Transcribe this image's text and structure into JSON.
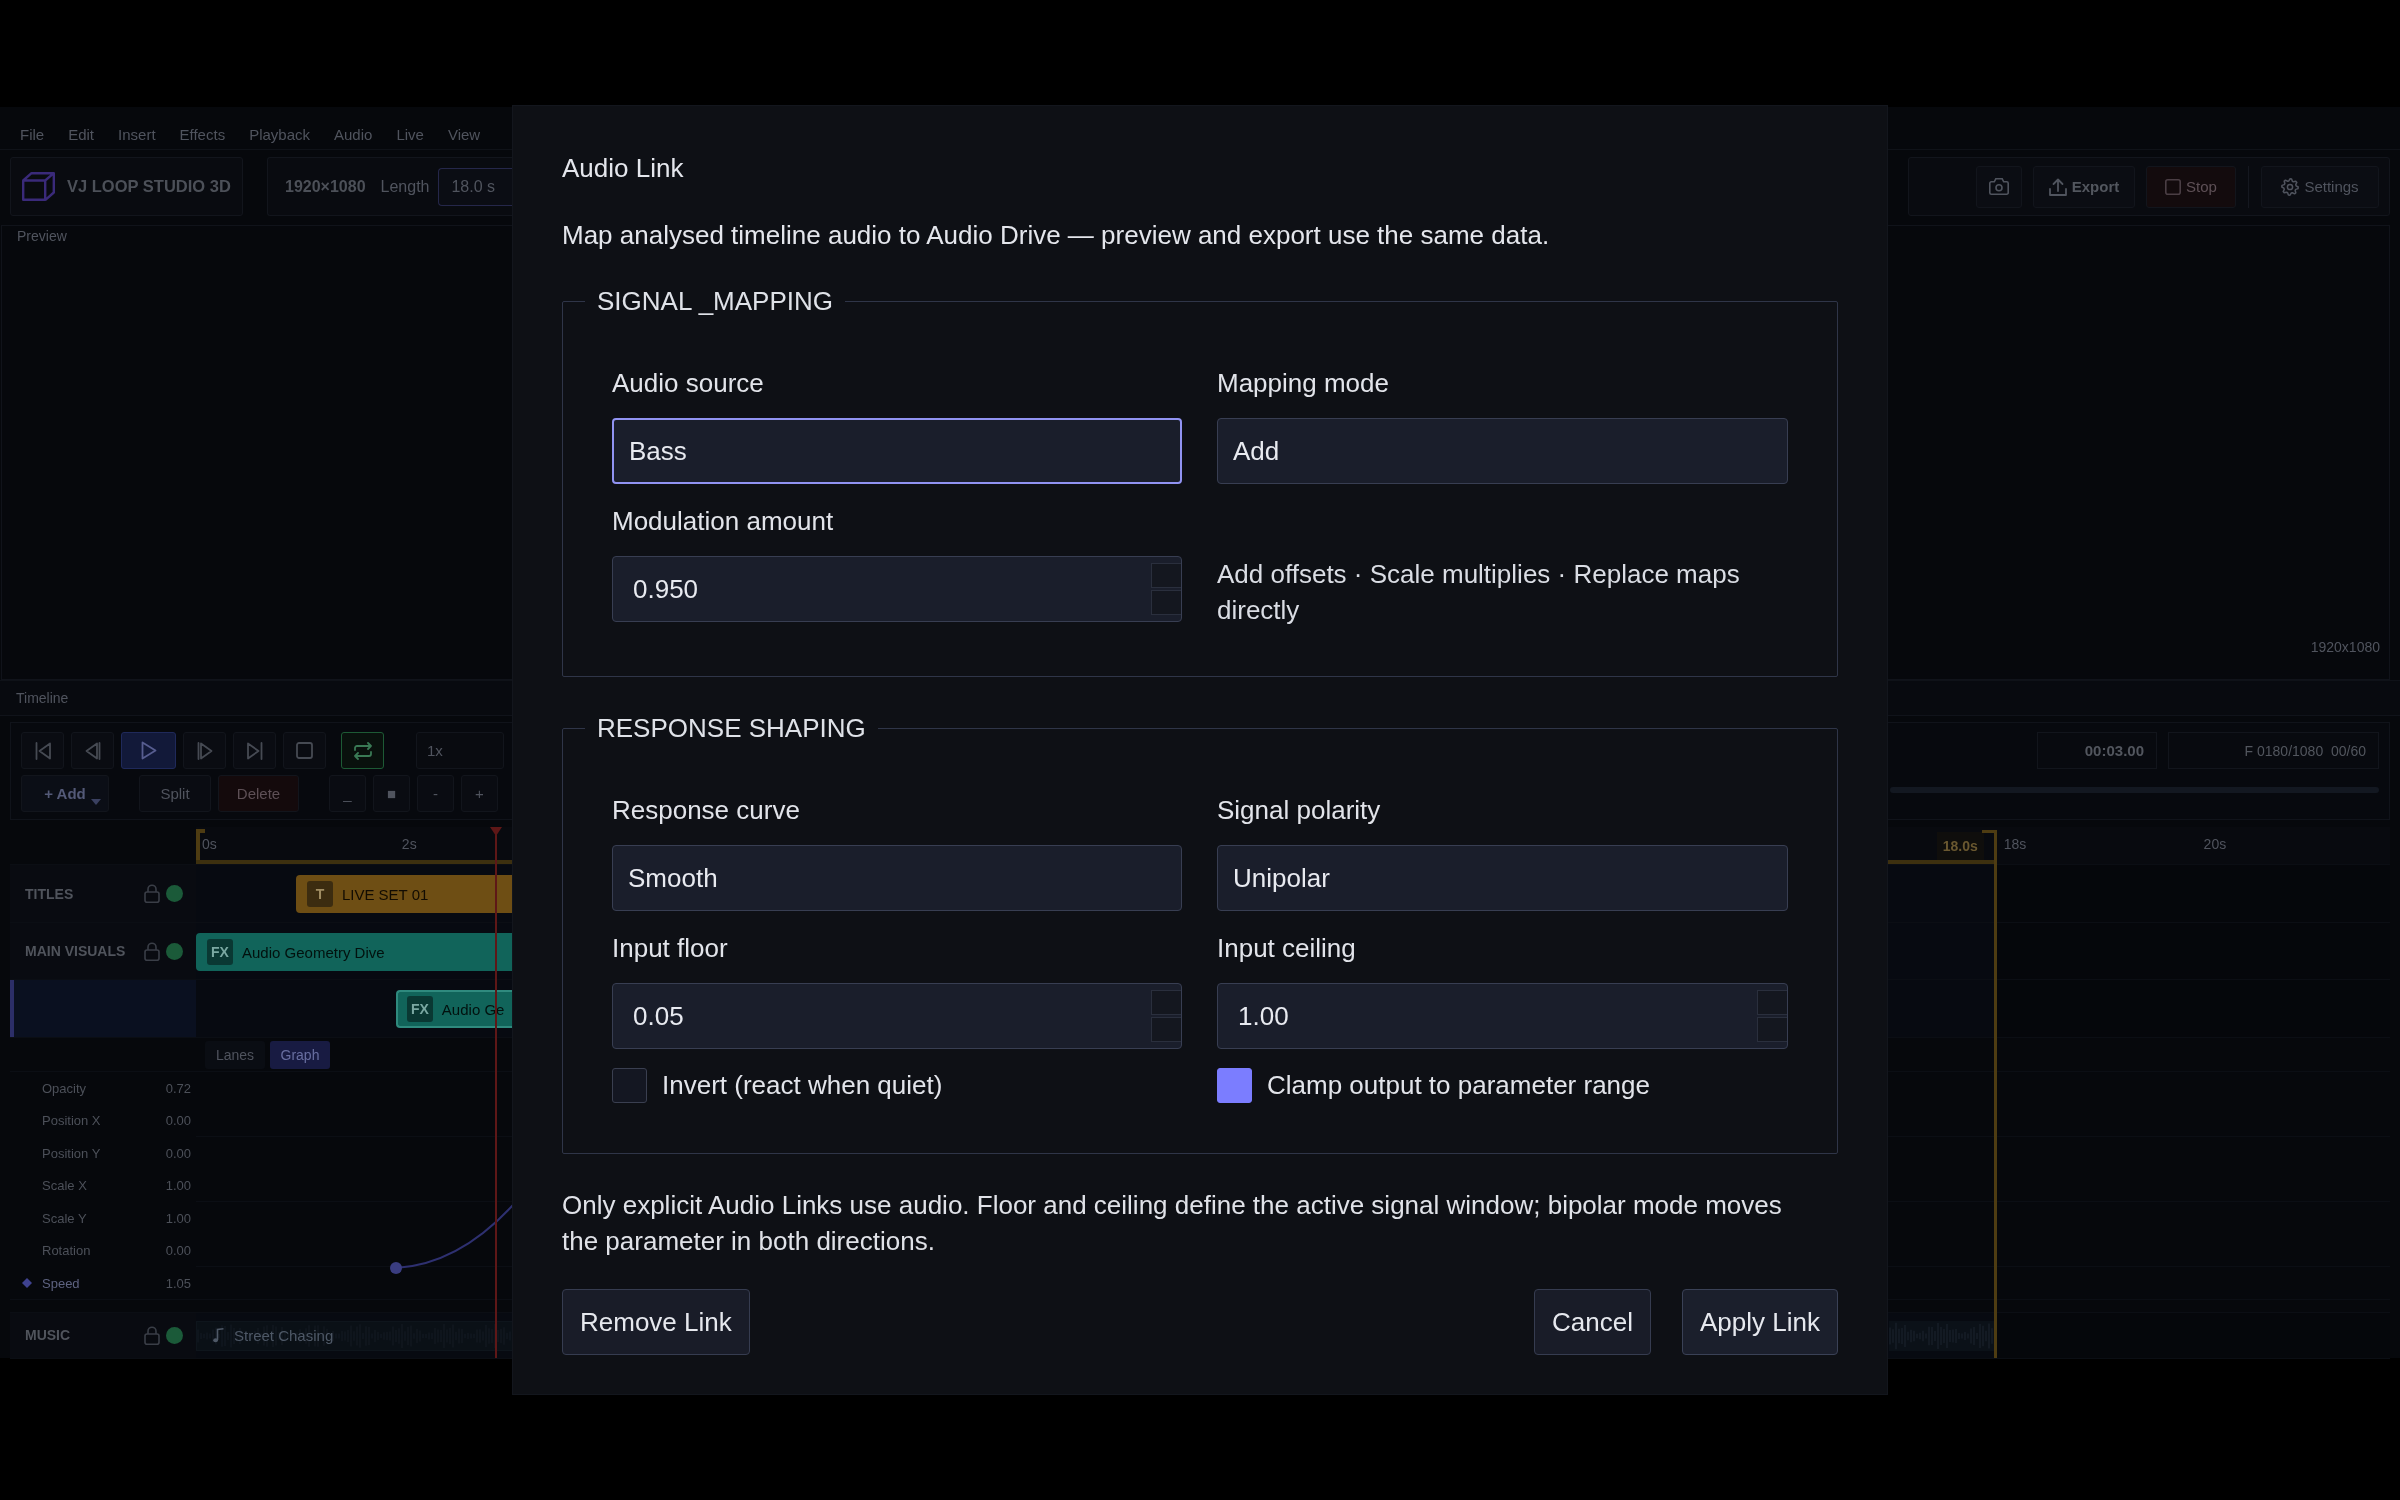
{
  "menu_bar": {
    "items": [
      "File",
      "Edit",
      "Insert",
      "Effects",
      "Playback",
      "Audio",
      "Live",
      "View"
    ]
  },
  "toolbar": {
    "brand": "VJ LOOP STUDIO 3D",
    "resolution": "1920×1080",
    "length_label": "Length",
    "length_value": "18.0 s",
    "actions": [
      {
        "kind": "camera"
      },
      {
        "kind": "export",
        "label": "Export"
      },
      {
        "kind": "stop",
        "label": "Stop"
      },
      {
        "kind": "settings",
        "label": "Settings"
      }
    ]
  },
  "preview": {
    "title": "Preview",
    "resolution": "1920x1080"
  },
  "timeline": {
    "title": "Timeline",
    "transport": [
      {
        "kind": "skip_start",
        "active": false
      },
      {
        "kind": "step_back",
        "active": false
      },
      {
        "kind": "play",
        "active": true
      },
      {
        "kind": "step_forward",
        "active": false
      },
      {
        "kind": "skip_end",
        "active": false
      },
      {
        "kind": "stop",
        "active": false
      },
      {
        "kind": "loop",
        "active": true
      }
    ],
    "speed": "1x",
    "edit_buttons": [
      {
        "kind": "add",
        "label": "+ Add"
      },
      {
        "kind": "plain",
        "label": "Split"
      },
      {
        "kind": "danger",
        "label": "Delete"
      }
    ],
    "zoom_buttons": [
      "_",
      "■",
      "-",
      "+"
    ],
    "timecode": "00:03.00",
    "frame_counter": "F 0180/1080  00/60",
    "ruler": {
      "ticks": [
        "0s",
        "2s",
        "18s",
        "20s"
      ],
      "loop_end": "18.0s"
    },
    "tracks": [
      {
        "name": "TITLES",
        "clips": [
          {
            "kind": "title",
            "badge": "T",
            "label": "LIVE SET 01",
            "selected": false
          }
        ]
      },
      {
        "name": "MAIN VISUALS",
        "clips": [
          {
            "kind": "fx",
            "badge": "FX",
            "label": "Audio Geometry Dive",
            "selected": false
          }
        ],
        "lane": {
          "selected": true,
          "clips": [
            {
              "kind": "fx",
              "badge": "FX",
              "label": "Audio Ge",
              "selected": true
            }
          ]
        },
        "graph": {
          "view_modes": [
            {
              "label": "Lanes",
              "selected": false
            },
            {
              "label": "Graph",
              "selected": true
            }
          ],
          "parameters": [
            {
              "name": "Opacity",
              "value": "0.72",
              "keyed": false
            },
            {
              "name": "Position X",
              "value": "0.00",
              "keyed": false
            },
            {
              "name": "Position Y",
              "value": "0.00",
              "keyed": false
            },
            {
              "name": "Scale X",
              "value": "1.00",
              "keyed": false
            },
            {
              "name": "Scale Y",
              "value": "1.00",
              "keyed": false
            },
            {
              "name": "Rotation",
              "value": "0.00",
              "keyed": false
            },
            {
              "name": "Speed",
              "value": "1.05",
              "keyed": true
            }
          ]
        }
      },
      {
        "name": "MUSIC",
        "clips": [
          {
            "kind": "audio",
            "label": "Street Chasing",
            "selected": false
          }
        ]
      }
    ]
  },
  "dialog": {
    "title": "Audio Link",
    "description": "Map analysed timeline audio to Audio Drive — preview and export use the same data.",
    "sections": [
      {
        "legend": "SIGNAL _MAPPING",
        "fields": [
          {
            "kind": "select",
            "label": "Audio source",
            "value": "Bass",
            "focused": true
          },
          {
            "kind": "select",
            "label": "Mapping mode",
            "value": "Add",
            "focused": false
          },
          {
            "kind": "number",
            "label": "Modulation amount",
            "value": "0.950",
            "focused": false
          },
          {
            "kind": "hint",
            "text": "Add offsets · Scale multiplies · Replace maps directly"
          }
        ]
      },
      {
        "legend": "RESPONSE SHAPING",
        "fields": [
          {
            "kind": "select",
            "label": "Response curve",
            "value": "Smooth",
            "focused": false
          },
          {
            "kind": "select",
            "label": "Signal polarity",
            "value": "Unipolar",
            "focused": false
          },
          {
            "kind": "number",
            "label": "Input floor",
            "value": "0.05",
            "focused": false
          },
          {
            "kind": "number",
            "label": "Input ceiling",
            "value": "1.00",
            "focused": false
          },
          {
            "kind": "checkbox",
            "label": "Invert (react when quiet)",
            "checked": false
          },
          {
            "kind": "checkbox",
            "label": "Clamp output to parameter range",
            "checked": true
          }
        ]
      }
    ],
    "note": "Only explicit Audio Links use audio. Floor and ceiling define the active signal window; bipolar mode moves the parameter in both directions.",
    "buttons": [
      {
        "kind": "secondary",
        "label": "Remove Link"
      },
      {
        "kind": "cancel",
        "label": "Cancel"
      },
      {
        "kind": "primary",
        "label": "Apply Link"
      }
    ]
  }
}
